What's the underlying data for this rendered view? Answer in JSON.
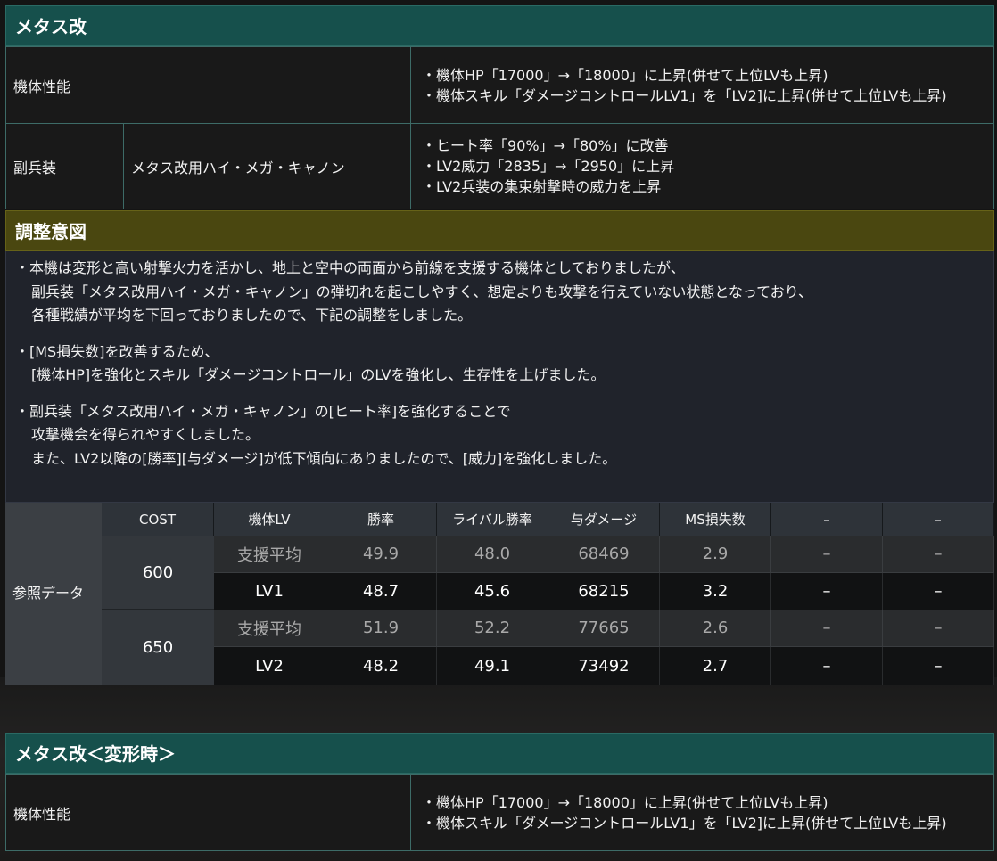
{
  "section1": {
    "title": "メタス改",
    "perf_label": "機体性能",
    "perf_notes": [
      "・機体HP「17000」→「18000」に上昇(併せて上位LVも上昇)",
      "・機体スキル「ダメージコントロールLV1」を「LV2]に上昇(併せて上位LVも上昇)"
    ],
    "sub_label": "副兵装",
    "sub_weapon": "メタス改用ハイ・メガ・キャノン",
    "sub_notes": [
      "・ヒート率「90%」→「80%」に改善",
      "・LV2威力「2835」→「2950」に上昇",
      "・LV2兵装の集束射撃時の威力を上昇"
    ]
  },
  "intent": {
    "title": "調整意図",
    "paragraphs": [
      [
        "・本機は変形と高い射撃火力を活かし、地上と空中の両面から前線を支援する機体としておりましたが、",
        "副兵装「メタス改用ハイ・メガ・キャノン」の弾切れを起こしやすく、想定よりも攻撃を行えていない状態となっており、",
        "各種戦績が平均を下回っておりましたので、下記の調整をしました。"
      ],
      [
        "・[MS損失数]を改善するため、",
        "[機体HP]を強化とスキル「ダメージコントロール」のLVを強化し、生存性を上げました。"
      ],
      [
        "・副兵装「メタス改用ハイ・メガ・キャノン」の[ヒート率]を強化することで",
        "攻撃機会を得られやすくしました。",
        "また、LV2以降の[勝率][与ダメージ]が低下傾向にありましたので、[威力]を強化しました。"
      ]
    ]
  },
  "ref": {
    "label": "参照データ",
    "headers": [
      "COST",
      "機体LV",
      "勝率",
      "ライバル勝率",
      "与ダメージ",
      "MS損失数",
      "–",
      "–"
    ],
    "groups": [
      {
        "cost": "600",
        "rows": [
          {
            "lv": "支援平均",
            "win": "49.9",
            "rival": "48.0",
            "dmg": "68469",
            "loss": "2.9",
            "c7": "–",
            "c8": "–"
          },
          {
            "lv": "LV1",
            "win": "48.7",
            "rival": "45.6",
            "dmg": "68215",
            "loss": "3.2",
            "c7": "–",
            "c8": "–"
          }
        ]
      },
      {
        "cost": "650",
        "rows": [
          {
            "lv": "支援平均",
            "win": "51.9",
            "rival": "52.2",
            "dmg": "77665",
            "loss": "2.6",
            "c7": "–",
            "c8": "–"
          },
          {
            "lv": "LV2",
            "win": "48.2",
            "rival": "49.1",
            "dmg": "73492",
            "loss": "2.7",
            "c7": "–",
            "c8": "–"
          }
        ]
      }
    ]
  },
  "section2": {
    "title": "メタス改＜変形時＞",
    "perf_label": "機体性能",
    "perf_notes": [
      "・機体HP「17000」→「18000」に上昇(併せて上位LVも上昇)",
      "・機体スキル「ダメージコントロールLV1」を「LV2]に上昇(併せて上位LVも上昇)"
    ]
  }
}
